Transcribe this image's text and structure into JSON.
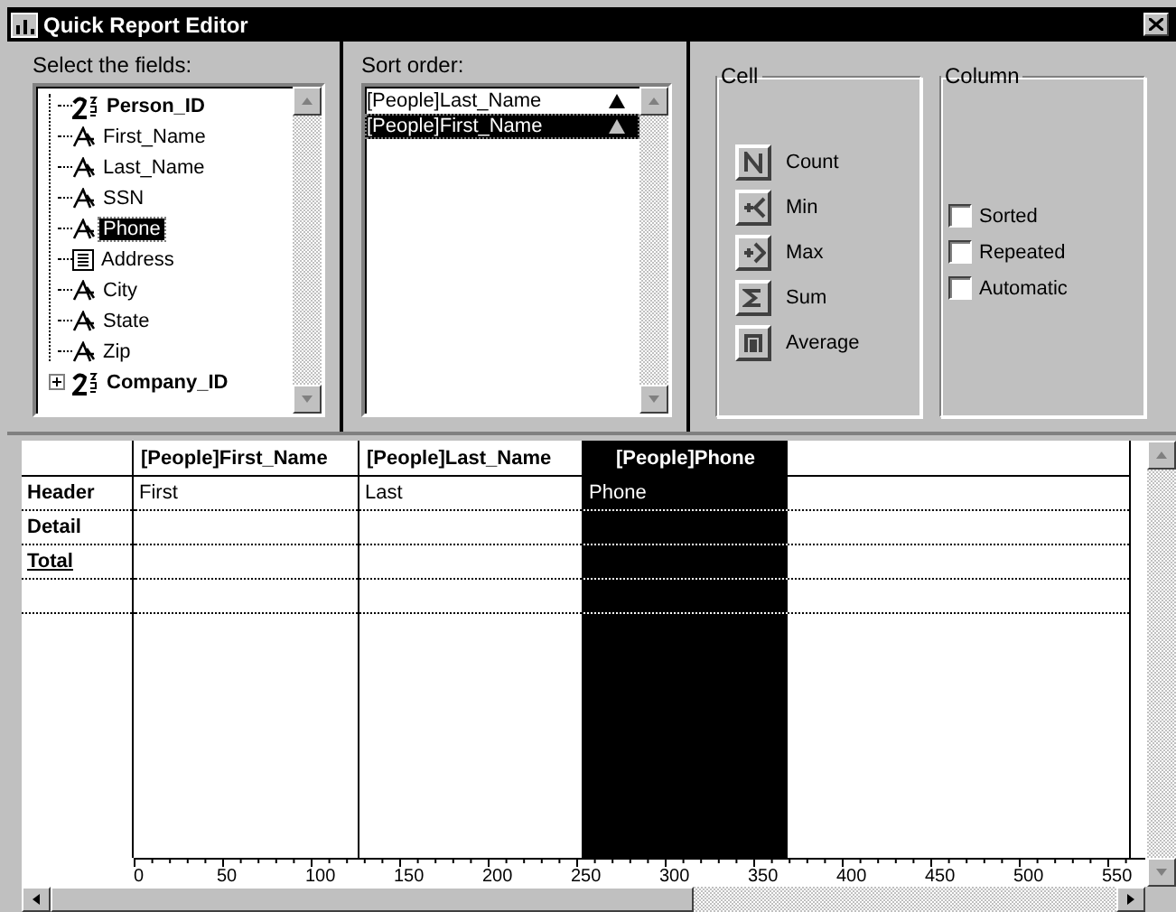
{
  "window": {
    "title": "Quick Report Editor"
  },
  "fields_panel": {
    "label": "Select the fields:",
    "items": [
      {
        "name": "Person_ID",
        "kind": "key",
        "selected": false
      },
      {
        "name": "First_Name",
        "kind": "text",
        "selected": false
      },
      {
        "name": "Last_Name",
        "kind": "text",
        "selected": false
      },
      {
        "name": "SSN",
        "kind": "text",
        "selected": false
      },
      {
        "name": "Phone",
        "kind": "text",
        "selected": true
      },
      {
        "name": "Address",
        "kind": "memo",
        "selected": false
      },
      {
        "name": "City",
        "kind": "text",
        "selected": false
      },
      {
        "name": "State",
        "kind": "text",
        "selected": false
      },
      {
        "name": "Zip",
        "kind": "text",
        "selected": false
      },
      {
        "name": "Company_ID",
        "kind": "key",
        "selected": false,
        "expanded": false
      }
    ]
  },
  "sort_panel": {
    "label": "Sort order:",
    "items": [
      {
        "name": "[People]Last_Name",
        "ascending": true,
        "selected": false
      },
      {
        "name": "[People]First_Name",
        "ascending": true,
        "selected": true
      }
    ]
  },
  "cell_group": {
    "title": "Cell",
    "buttons": [
      {
        "kind": "count",
        "label": "Count"
      },
      {
        "kind": "min",
        "label": "Min"
      },
      {
        "kind": "max",
        "label": "Max"
      },
      {
        "kind": "sum",
        "label": "Sum"
      },
      {
        "kind": "average",
        "label": "Average"
      }
    ]
  },
  "column_group": {
    "title": "Column",
    "options": [
      {
        "label": "Sorted",
        "checked": false
      },
      {
        "label": "Repeated",
        "checked": false
      },
      {
        "label": "Automatic",
        "checked": false
      }
    ]
  },
  "grid": {
    "columns": [
      {
        "title": "[People]First_Name",
        "selected": false
      },
      {
        "title": "[People]Last_Name",
        "selected": false
      },
      {
        "title": "[People]Phone",
        "selected": true
      }
    ],
    "rows": [
      {
        "label": "Header",
        "underlined": false,
        "cells": [
          "First",
          "Last",
          "Phone"
        ]
      },
      {
        "label": "Detail",
        "underlined": false
      },
      {
        "label": "Total",
        "underlined": true
      }
    ],
    "ruler": [
      "0",
      "50",
      "100",
      "150",
      "200",
      "250",
      "300",
      "350",
      "400",
      "450",
      "500",
      "550"
    ]
  }
}
